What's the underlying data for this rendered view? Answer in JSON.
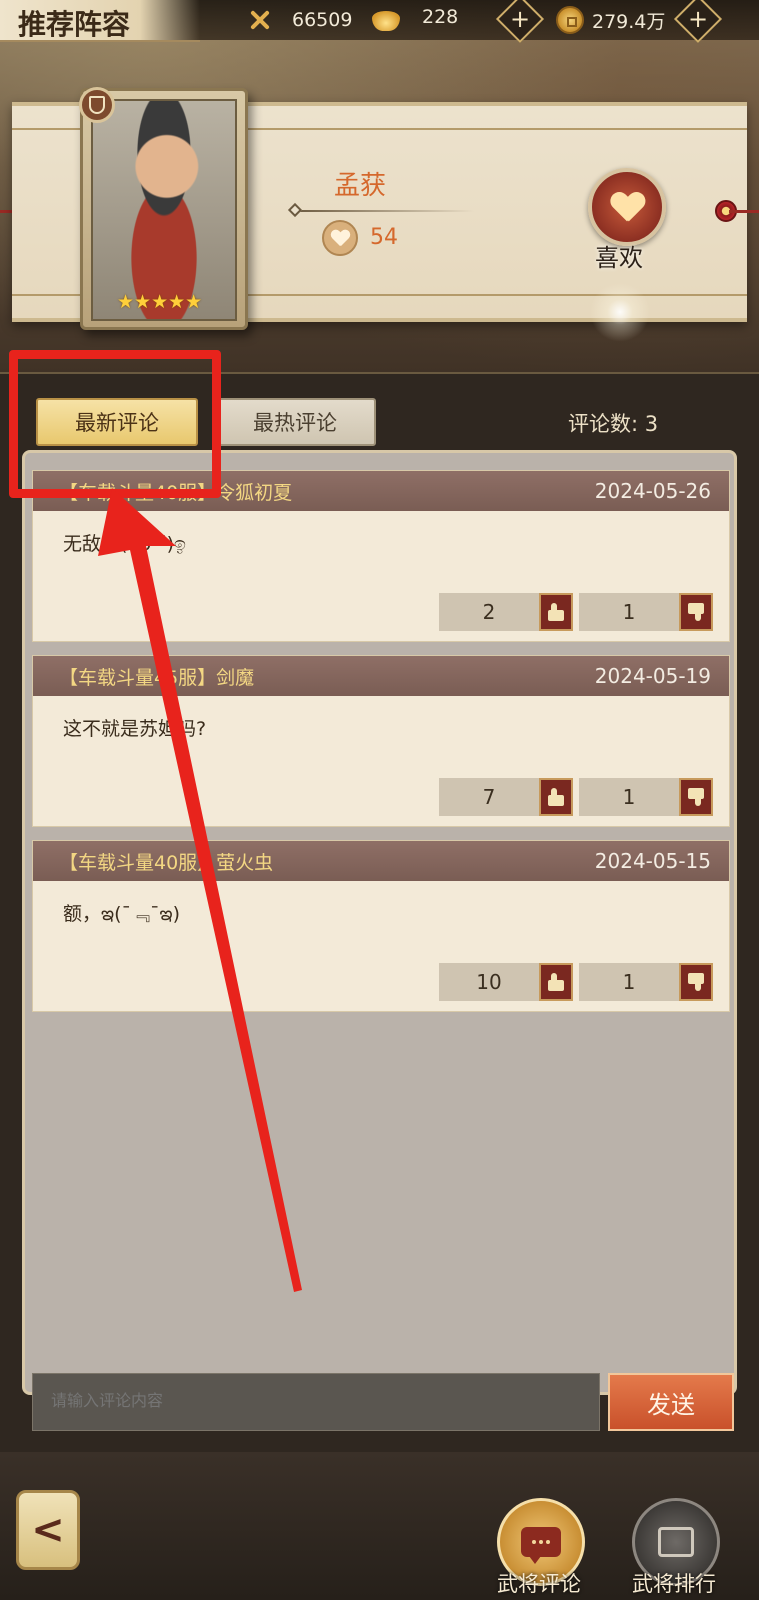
{
  "header": {
    "title": "推荐阵容",
    "resources": [
      {
        "icon": "crossed-swords-icon",
        "value": "66509"
      },
      {
        "icon": "gold-ingot-icon",
        "value": "228"
      },
      {
        "icon": "copper-coin-icon",
        "value": "279.4万"
      }
    ],
    "add_label": "+"
  },
  "hero": {
    "name": "孟获",
    "stars": "★★★★★",
    "likes": "54",
    "like_button_label": "喜欢"
  },
  "comments": {
    "tabs": [
      {
        "label": "最新评论",
        "active": true
      },
      {
        "label": "最热评论",
        "active": false
      }
    ],
    "count_text": "评论数: 3",
    "items": [
      {
        "user": "【车载斗量40服】令狐初夏",
        "date": "2024-05-26",
        "text": "无敌了(๑ó ˇ)ඉ",
        "up": "2",
        "down": "1"
      },
      {
        "user": "【车载斗量45服】剑魔",
        "date": "2024-05-19",
        "text": "这不就是苏妲吗?",
        "up": "7",
        "down": "1"
      },
      {
        "user": "【车载斗量40服】萤火虫",
        "date": "2024-05-15",
        "text": "额，ఇ(ˉ﹃ˉఇ)",
        "up": "10",
        "down": "1"
      }
    ],
    "input_placeholder": "请输入评论内容",
    "send_label": "发送"
  },
  "bottom_nav": {
    "back_label": "<",
    "items": [
      {
        "label": "武将评论",
        "icon": "chat-bubble-icon"
      },
      {
        "label": "武将排行",
        "icon": "ranking-icon"
      }
    ]
  },
  "colors": {
    "accent_orange": "#d5682c",
    "annotation_red": "#e8231c",
    "card_header": "#7a5d54",
    "tab_active": "#e8c86e"
  }
}
